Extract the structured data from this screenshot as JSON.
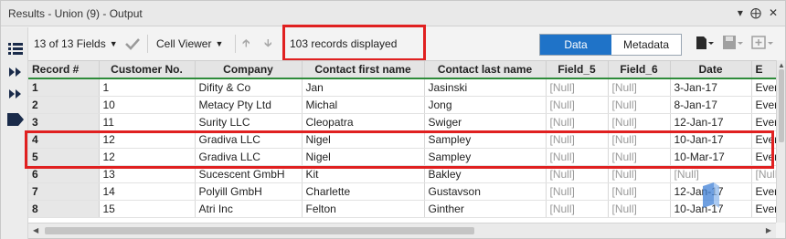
{
  "window": {
    "title": "Results - Union (9) - Output"
  },
  "title_controls": [
    "▾",
    "⨁",
    "✕"
  ],
  "toolbar": {
    "fields_label": "13 of 13 Fields",
    "viewer_label": "Cell Viewer",
    "records_label": "103 records displayed",
    "data_tab": "Data",
    "metadata_tab": "Metadata"
  },
  "table": {
    "headers": [
      "Record #",
      "Customer No.",
      "Company",
      "Contact first name",
      "Contact last name",
      "Field_5",
      "Field_6",
      "Date",
      "E"
    ],
    "rows": [
      [
        "1",
        "1",
        "Difity & Co",
        "Jan",
        "Jasinski",
        "[Null]",
        "[Null]",
        "3-Jan-17",
        "Ever"
      ],
      [
        "2",
        "10",
        "Metacy Pty Ltd",
        "Michal",
        "Jong",
        "[Null]",
        "[Null]",
        "8-Jan-17",
        "Ever"
      ],
      [
        "3",
        "11",
        "Surity LLC",
        "Cleopatra",
        "Swiger",
        "[Null]",
        "[Null]",
        "12-Jan-17",
        "Ever"
      ],
      [
        "4",
        "12",
        "Gradiva LLC",
        "Nigel",
        "Sampley",
        "[Null]",
        "[Null]",
        "10-Jan-17",
        "Ever"
      ],
      [
        "5",
        "12",
        "Gradiva LLC",
        "Nigel",
        "Sampley",
        "[Null]",
        "[Null]",
        "10-Mar-17",
        "Ever"
      ],
      [
        "6",
        "13",
        "Sucescent GmbH",
        "Kit",
        "Bakley",
        "[Null]",
        "[Null]",
        "[Null]",
        "[Null]"
      ],
      [
        "7",
        "14",
        "Polyill GmbH",
        "Charlette",
        "Gustavson",
        "[Null]",
        "[Null]",
        "12-Jan-17",
        "Ever"
      ],
      [
        "8",
        "15",
        "Atri Inc",
        "Felton",
        "Ginther",
        "[Null]",
        "[Null]",
        "10-Jan-17",
        "Ever"
      ]
    ]
  },
  "colors": {
    "accent": "#1f73c8",
    "highlight": "#e02020",
    "header_underline": "#2e8b3a"
  }
}
